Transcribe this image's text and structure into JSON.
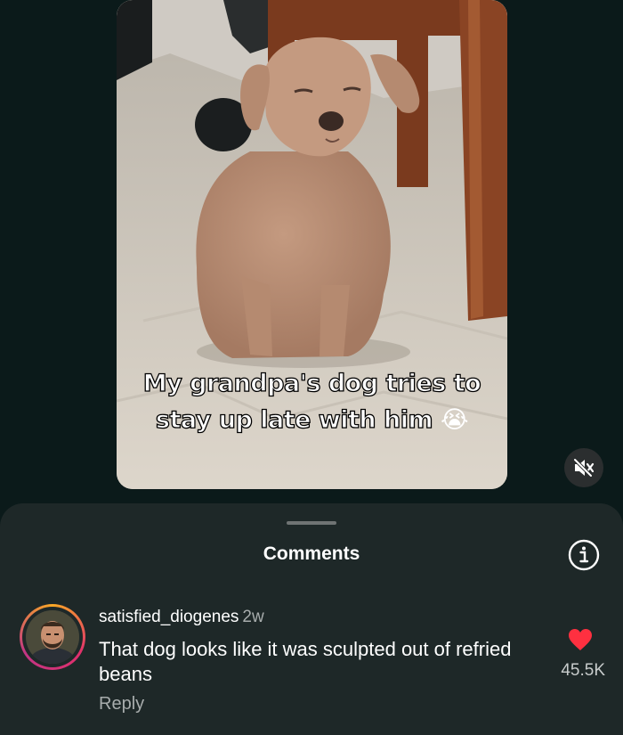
{
  "video": {
    "caption_line1": "My grandpa's dog tries to",
    "caption_line2": "stay up late with him",
    "caption_emoji": "😭"
  },
  "comments_sheet": {
    "title": "Comments",
    "comment": {
      "username": "satisfied_diogenes",
      "time": "2w",
      "text": "That dog looks like it was sculpted out of refried beans",
      "reply_label": "Reply",
      "like_count": "45.5K"
    }
  },
  "colors": {
    "background": "#0b1a1a",
    "sheet": "#1e2828",
    "like_heart": "#ff3040"
  },
  "icons": [
    "mute-icon",
    "info-icon",
    "heart-icon"
  ]
}
